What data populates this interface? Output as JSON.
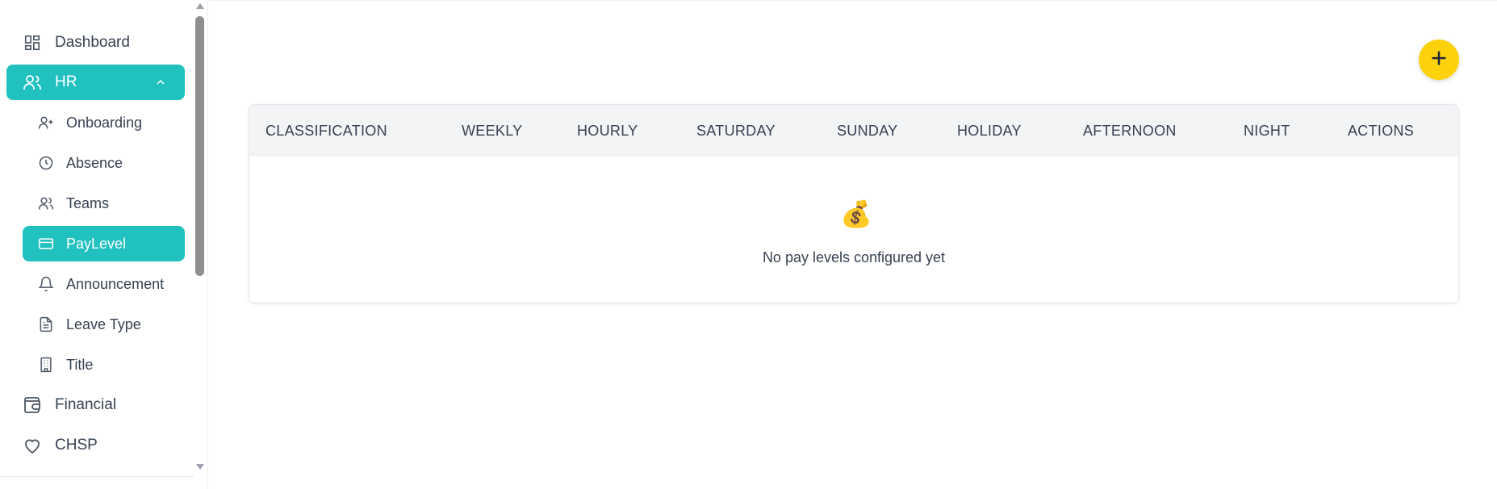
{
  "sidebar": {
    "items": [
      {
        "label": "Dashboard",
        "icon": "dashboard-grid-icon"
      },
      {
        "label": "HR",
        "icon": "users-icon",
        "expanded": true
      },
      {
        "label": "Onboarding",
        "icon": "user-plus-icon"
      },
      {
        "label": "Absence",
        "icon": "clock-icon"
      },
      {
        "label": "Teams",
        "icon": "users-icon"
      },
      {
        "label": "PayLevel",
        "icon": "credit-card-icon",
        "active": true
      },
      {
        "label": "Announcement",
        "icon": "bell-icon"
      },
      {
        "label": "Leave Type",
        "icon": "document-icon"
      },
      {
        "label": "Title",
        "icon": "building-icon"
      },
      {
        "label": "Financial",
        "icon": "wallet-icon"
      },
      {
        "label": "CHSP",
        "icon": "heart-icon"
      }
    ]
  },
  "main": {
    "add_button_icon": "plus-icon",
    "table": {
      "columns": [
        "CLASSIFICATION",
        "WEEKLY",
        "HOURLY",
        "SATURDAY",
        "SUNDAY",
        "HOLIDAY",
        "AFTERNOON",
        "NIGHT",
        "ACTIONS"
      ],
      "empty_icon": "money-bag-emoji",
      "empty_glyph": "💰",
      "empty_message": "No pay levels configured yet"
    }
  },
  "colors": {
    "accent": "#20c1bf",
    "fab": "#fdd20a",
    "header_bg": "#f3f4f6"
  }
}
